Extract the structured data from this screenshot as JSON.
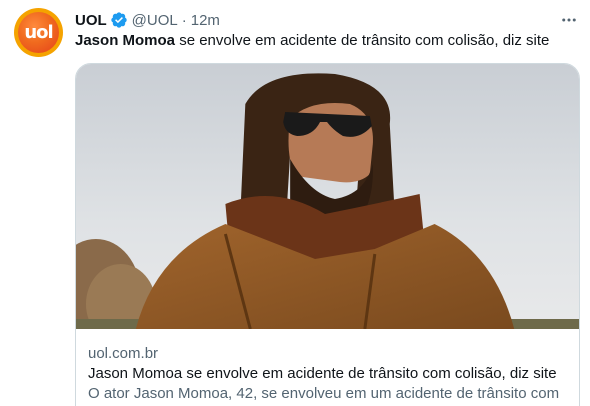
{
  "author": {
    "display_name": "UOL",
    "handle": "@UOL",
    "separator": "·",
    "time": "12m",
    "avatar_text": "uol"
  },
  "tweet": {
    "bold_text": "Jason Momoa",
    "text": " se envolve em acidente de trânsito com colisão, diz site"
  },
  "card": {
    "domain": "uol.com.br",
    "title": "Jason Momoa se envolve em acidente de trânsito com colisão, diz site",
    "description": "O ator Jason Momoa, 42, se envolveu em um acidente de trânsito com"
  },
  "colors": {
    "verified": "#1d9bf0",
    "text_primary": "#0f1419",
    "text_secondary": "#536471",
    "border": "#cfd9de",
    "brand": "#f06a1e"
  },
  "icons": {
    "verified": "verified-badge-icon",
    "more": "more-options-icon"
  }
}
